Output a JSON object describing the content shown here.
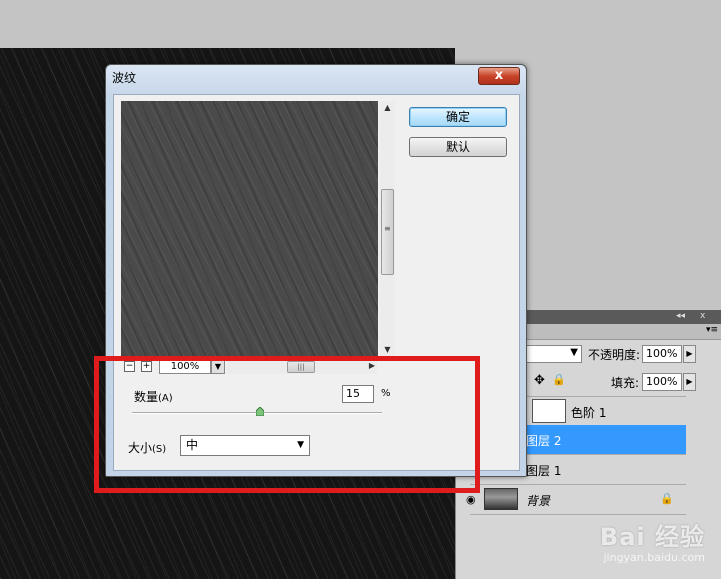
{
  "dialog": {
    "title": "波纹",
    "close_label": "x",
    "ok_label": "确定",
    "default_label": "默认",
    "zoom": {
      "minus": "−",
      "plus": "+",
      "value": "100%"
    },
    "amount": {
      "label": "数量",
      "shortcut": "(A)",
      "value": "15",
      "unit": "%",
      "fraction": 0.51
    },
    "size": {
      "label": "大小",
      "shortcut": "(S)",
      "value": "中"
    }
  },
  "layers_panel": {
    "collapse_label": "◂◂",
    "close_label": "x",
    "menu_label": "▾≡",
    "opacity_label": "不透明度:",
    "opacity_value": "100%",
    "fill_label": "填充:",
    "fill_value": "100%",
    "layers": [
      {
        "name": "色阶 1",
        "selected": false
      },
      {
        "name": "图层 2",
        "selected": true
      },
      {
        "name": "图层 1",
        "selected": false
      },
      {
        "name": "背景",
        "selected": false
      }
    ]
  },
  "watermark": {
    "logo": "Bai 经验",
    "site": "jingyan.baidu.com"
  },
  "colors": {
    "selection": "#3399ff",
    "annotation": "#e01b1b",
    "close_button": "#c7442a"
  }
}
